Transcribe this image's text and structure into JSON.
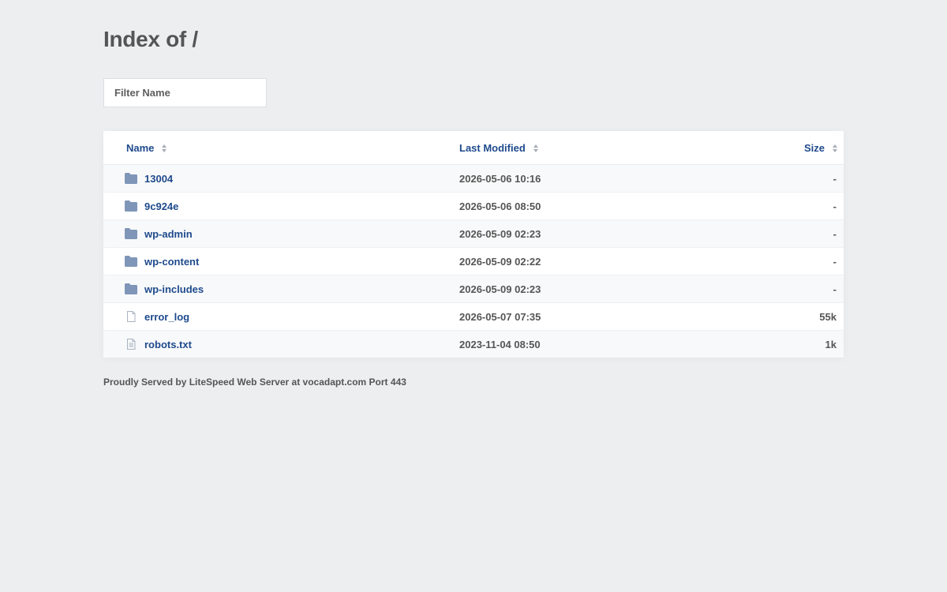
{
  "page": {
    "title": "Index of /",
    "filter_placeholder": "Filter Name"
  },
  "table": {
    "headers": {
      "name": "Name",
      "last_modified": "Last Modified",
      "size": "Size"
    },
    "rows": [
      {
        "type": "folder",
        "icon": "folder-icon",
        "name": "13004",
        "modified": "2026-05-06 10:16",
        "size": "-"
      },
      {
        "type": "folder",
        "icon": "folder-icon",
        "name": "9c924e",
        "modified": "2026-05-06 08:50",
        "size": "-"
      },
      {
        "type": "folder",
        "icon": "folder-icon",
        "name": "wp-admin",
        "modified": "2026-05-09 02:23",
        "size": "-"
      },
      {
        "type": "folder",
        "icon": "folder-icon",
        "name": "wp-content",
        "modified": "2026-05-09 02:22",
        "size": "-"
      },
      {
        "type": "folder",
        "icon": "folder-icon",
        "name": "wp-includes",
        "modified": "2026-05-09 02:23",
        "size": "-"
      },
      {
        "type": "file",
        "icon": "file-icon",
        "name": "error_log",
        "modified": "2026-05-07 07:35",
        "size": "55k"
      },
      {
        "type": "text",
        "icon": "text-file-icon",
        "name": "robots.txt",
        "modified": "2023-11-04 08:50",
        "size": "1k"
      }
    ]
  },
  "footer": {
    "text": "Proudly Served by LiteSpeed Web Server at vocadapt.com Port 443"
  },
  "colors": {
    "background": "#eceef0",
    "link": "#1e4a8c",
    "folder_icon": "#7f96b8",
    "file_icon": "#a9b4c2"
  }
}
